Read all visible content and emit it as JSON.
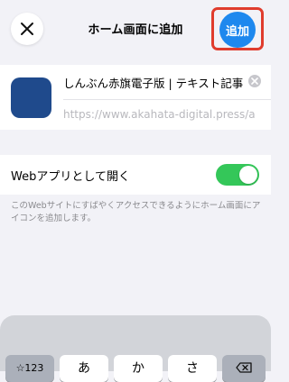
{
  "header": {
    "title": "ホーム画面に追加",
    "add_label": "追加"
  },
  "app": {
    "name": "しんぶん赤旗電子版 | テキスト記事",
    "url": "https://www.akahata-digital.press/a",
    "icon_color": "#1f4a8c"
  },
  "webapp": {
    "label": "Webアプリとして開く",
    "enabled": true,
    "description": "このWebサイトにすばやくアクセスできるようにホーム画面にアイコンを追加します。"
  },
  "keyboard": {
    "keys": [
      "☆123",
      "あ",
      "か",
      "さ"
    ]
  },
  "colors": {
    "accent": "#1e88ee",
    "toggle_on": "#34c759",
    "highlight": "#e03c2d"
  }
}
